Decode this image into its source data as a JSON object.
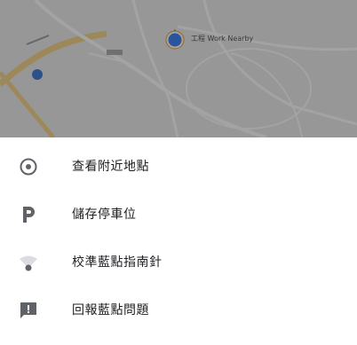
{
  "map": {
    "place_label": "工程 Work Nearby"
  },
  "menu": {
    "items": [
      {
        "label": "查看附近地點",
        "icon": "target-icon"
      },
      {
        "label": "儲存停車位",
        "icon": "parking-icon"
      },
      {
        "label": "校準藍點指南針",
        "icon": "compass-beam-icon"
      },
      {
        "label": "回報藍點問題",
        "icon": "feedback-icon"
      }
    ]
  },
  "colors": {
    "icon": "#5f6368",
    "text": "#202124",
    "location_dot": "#4285f4"
  }
}
